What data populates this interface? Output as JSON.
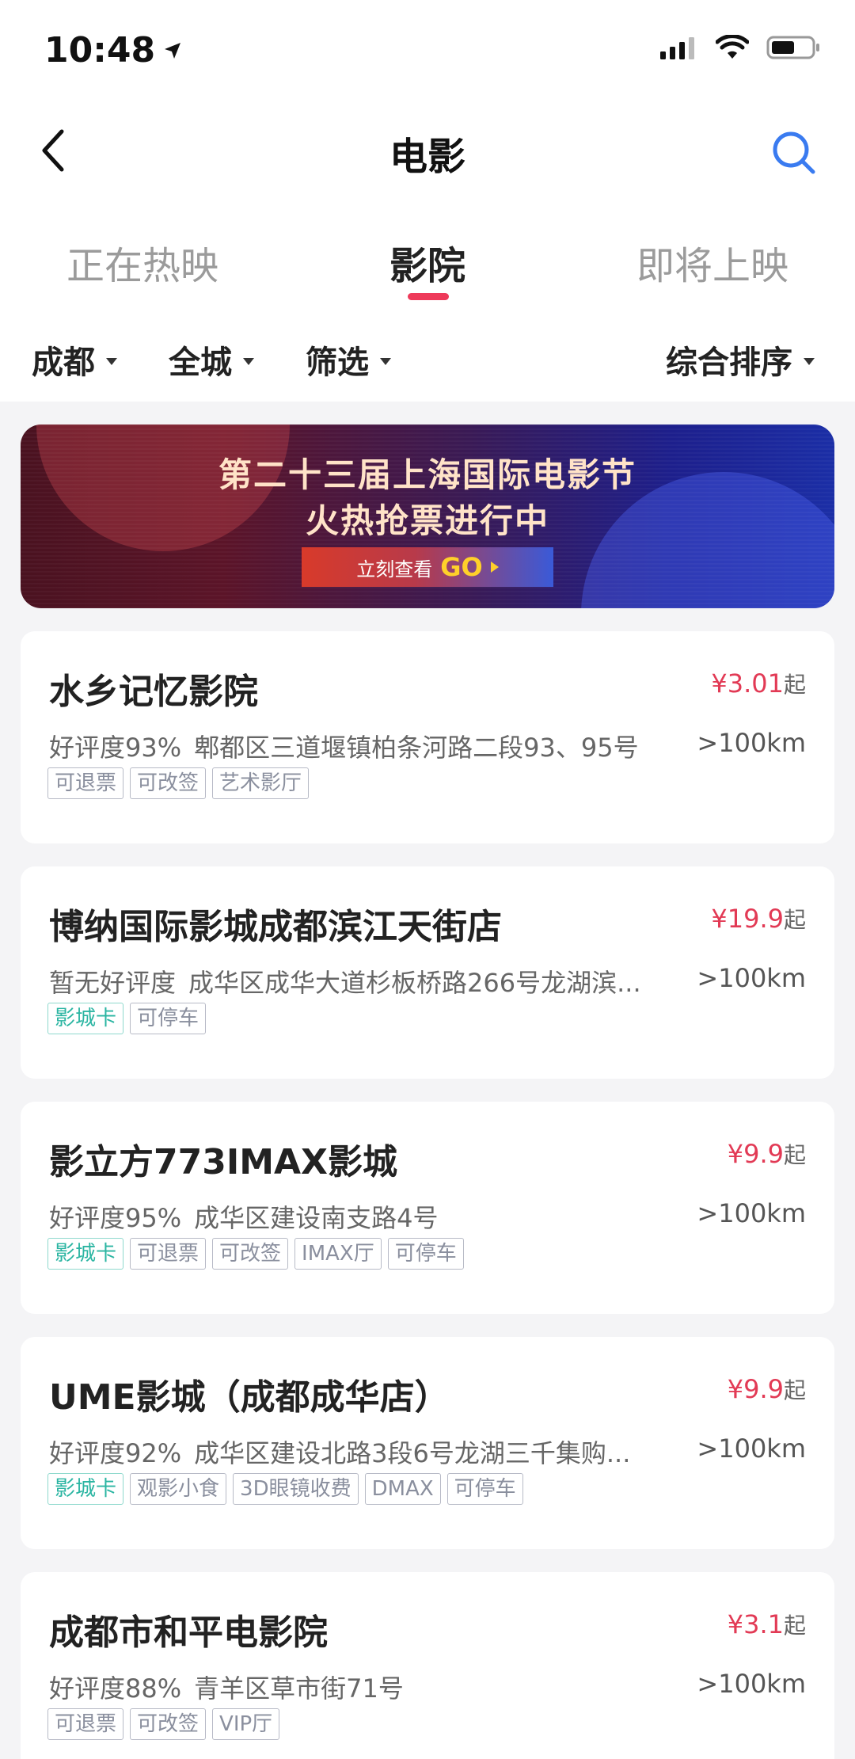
{
  "status": {
    "time": "10:48"
  },
  "nav": {
    "title": "电影"
  },
  "tabs": [
    {
      "label": "正在热映",
      "active": false
    },
    {
      "label": "影院",
      "active": true
    },
    {
      "label": "即将上映",
      "active": false
    }
  ],
  "filters": {
    "city": "成都",
    "area": "全城",
    "filter": "筛选",
    "sort": "综合排序"
  },
  "banner": {
    "line1": "第二十三届上海国际电影节",
    "line2": "火热抢票进行中",
    "button_text": "立刻查看",
    "button_go": "GO"
  },
  "cinemas": [
    {
      "name": "水乡记忆影院",
      "price": "¥3.01",
      "price_suffix": "起",
      "rating": "好评度93%",
      "address": "郫都区三道堰镇柏条河路二段93、95号",
      "distance": ">100km",
      "tags": [
        {
          "label": "可退票",
          "style": "gray"
        },
        {
          "label": "可改签",
          "style": "gray"
        },
        {
          "label": "艺术影厅",
          "style": "gray"
        }
      ]
    },
    {
      "name": "博纳国际影城成都滨江天街店",
      "price": "¥19.9",
      "price_suffix": "起",
      "rating": "暂无好评度",
      "address": "成华区成华大道杉板桥路266号龙湖滨...",
      "distance": ">100km",
      "tags": [
        {
          "label": "影城卡",
          "style": "teal"
        },
        {
          "label": "可停车",
          "style": "gray"
        }
      ]
    },
    {
      "name": "影立方773IMAX影城",
      "price": "¥9.9",
      "price_suffix": "起",
      "rating": "好评度95%",
      "address": "成华区建设南支路4号",
      "distance": ">100km",
      "tags": [
        {
          "label": "影城卡",
          "style": "teal"
        },
        {
          "label": "可退票",
          "style": "gray"
        },
        {
          "label": "可改签",
          "style": "gray"
        },
        {
          "label": "IMAX厅",
          "style": "gray"
        },
        {
          "label": "可停车",
          "style": "gray"
        }
      ]
    },
    {
      "name": "UME影城（成都成华店）",
      "price": "¥9.9",
      "price_suffix": "起",
      "rating": "好评度92%",
      "address": "成华区建设北路3段6号龙湖三千集购...",
      "distance": ">100km",
      "tags": [
        {
          "label": "影城卡",
          "style": "teal"
        },
        {
          "label": "观影小食",
          "style": "gray"
        },
        {
          "label": "3D眼镜收费",
          "style": "gray"
        },
        {
          "label": "DMAX",
          "style": "gray"
        },
        {
          "label": "可停车",
          "style": "gray"
        }
      ]
    },
    {
      "name": "成都市和平电影院",
      "price": "¥3.1",
      "price_suffix": "起",
      "rating": "好评度88%",
      "address": "青羊区草市街71号",
      "distance": ">100km",
      "tags": [
        {
          "label": "可退票",
          "style": "gray"
        },
        {
          "label": "可改签",
          "style": "gray"
        },
        {
          "label": "VIP厅",
          "style": "gray"
        }
      ]
    }
  ]
}
